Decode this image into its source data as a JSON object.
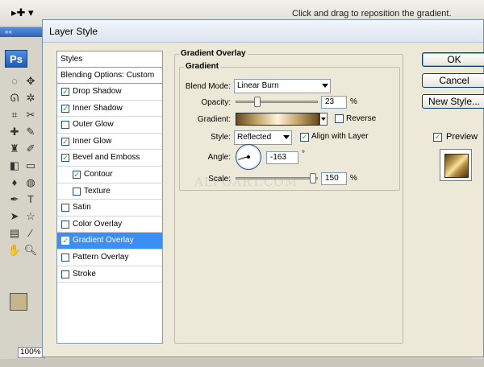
{
  "ps": {
    "hint": "Click and drag to reposition the gradient.",
    "zoom": "100%",
    "logo": "Ps",
    "fg_color": "#c5b48c",
    "bg_color": "#f3a6a8"
  },
  "dialog": {
    "title": "Layer Style",
    "styles_header": "Styles",
    "blending": "Blending Options: Custom",
    "items": [
      {
        "label": "Drop Shadow",
        "checked": true
      },
      {
        "label": "Inner Shadow",
        "checked": true
      },
      {
        "label": "Outer Glow",
        "checked": false
      },
      {
        "label": "Inner Glow",
        "checked": true
      },
      {
        "label": "Bevel and Emboss",
        "checked": true
      },
      {
        "label": "Contour",
        "checked": true,
        "sub": true
      },
      {
        "label": "Texture",
        "checked": false,
        "sub": true
      },
      {
        "label": "Satin",
        "checked": false
      },
      {
        "label": "Color Overlay",
        "checked": false
      },
      {
        "label": "Gradient Overlay",
        "checked": true,
        "active": true
      },
      {
        "label": "Pattern Overlay",
        "checked": false
      },
      {
        "label": "Stroke",
        "checked": false
      }
    ]
  },
  "overlay": {
    "group_title": "Gradient Overlay",
    "sub_title": "Gradient",
    "blend_label": "Blend Mode:",
    "blend_value": "Linear Burn",
    "opacity_label": "Opacity:",
    "opacity_value": "23",
    "opacity_fraction": 0.23,
    "pct": "%",
    "gradient_label": "Gradient:",
    "reverse_label": "Reverse",
    "style_label": "Style:",
    "style_value": "Reflected",
    "align_label": "Align with Layer",
    "angle_label": "Angle:",
    "angle_value": "-163",
    "deg": "°",
    "scale_label": "Scale:",
    "scale_value": "150",
    "watermark": "ALFOART.COM"
  },
  "buttons": {
    "ok": "OK",
    "cancel": "Cancel",
    "new_style": "New Style...",
    "preview": "Preview"
  }
}
